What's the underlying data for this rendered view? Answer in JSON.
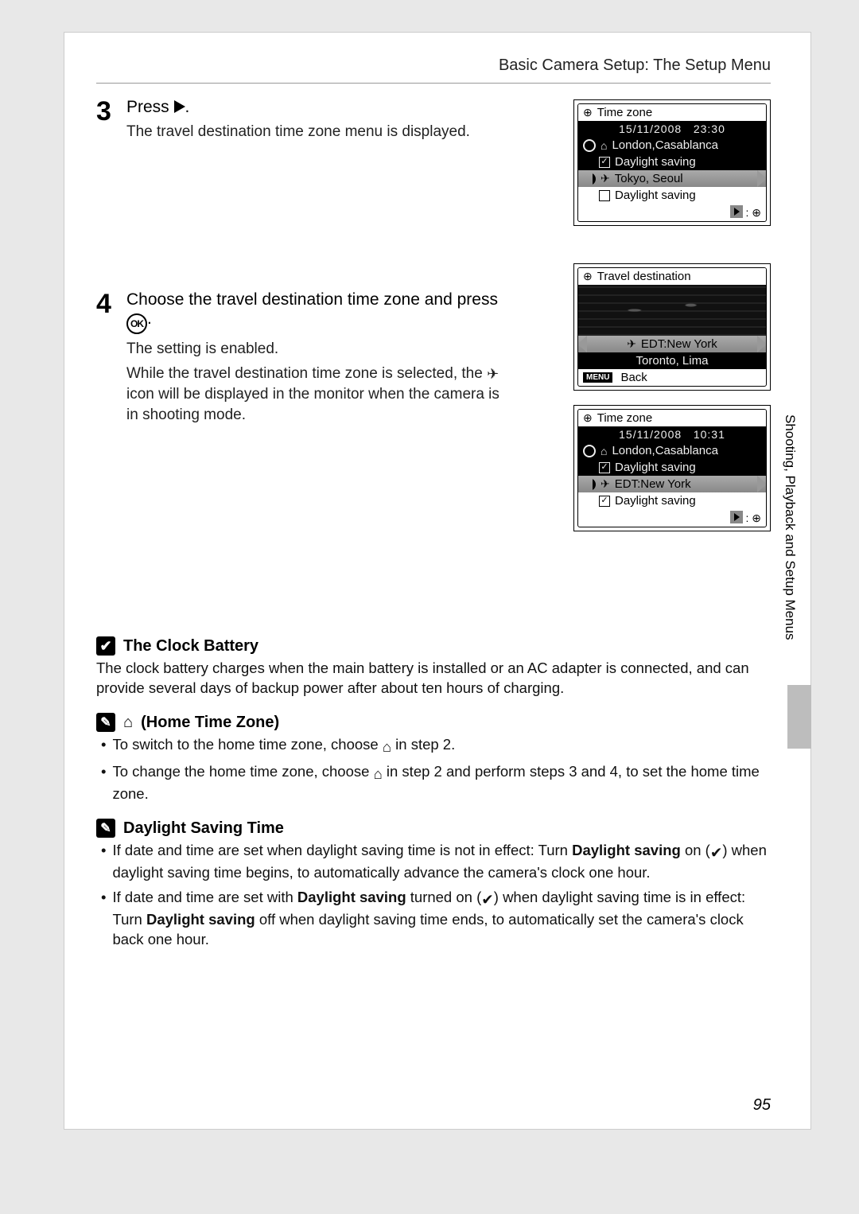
{
  "header": {
    "title": "Basic Camera Setup: The Setup Menu"
  },
  "step3": {
    "num": "3",
    "title_prefix": "Press ",
    "title_suffix": ".",
    "desc": "The travel destination time zone menu is displayed."
  },
  "step4": {
    "num": "4",
    "title_a": "Choose the travel destination time zone and press ",
    "title_b": ".",
    "desc1": "The setting is enabled.",
    "desc2a": "While the travel destination time zone is selected, the ",
    "desc2b": " icon will be displayed in the monitor when the camera is in shooting mode."
  },
  "lcd1": {
    "title": "Time zone",
    "date": "15/11/2008",
    "time": "23:30",
    "home": "London,Casablanca",
    "dst1": "Daylight saving",
    "dest": "Tokyo, Seoul",
    "dst2": "Daylight saving"
  },
  "lcd2": {
    "title": "Travel destination",
    "sel": "EDT:New York",
    "alt": "Toronto, Lima",
    "back": "Back"
  },
  "lcd3": {
    "title": "Time zone",
    "date": "15/11/2008",
    "time": "10:31",
    "home": "London,Casablanca",
    "dst1": "Daylight saving",
    "dest": "EDT:New York",
    "dst2": "Daylight saving"
  },
  "side_label": "Shooting, Playback and Setup Menus",
  "notes": {
    "clock": {
      "title": "The Clock Battery",
      "body": "The clock battery charges when the main battery is installed or an AC adapter is connected, and can provide several days of backup power after about ten hours of charging."
    },
    "home": {
      "title": "(Home Time Zone)",
      "b1a": "To switch to the home time zone, choose ",
      "b1b": " in step 2.",
      "b2a": "To change the home time zone, choose ",
      "b2b": " in step 2 and perform steps 3 and 4, to set the home time zone."
    },
    "dst_title": "Daylight Saving Time",
    "dst": {
      "b1a": "If date and time are set when daylight saving time is not in effect: Turn ",
      "b1bold": "Daylight saving",
      "b1b": " on (",
      "b1c": ") when daylight saving time begins, to automatically advance the camera's clock one hour.",
      "b2a": "If date and time are set with ",
      "b2bold1": "Daylight saving",
      "b2b": " turned on (",
      "b2c": ") when daylight saving time is in effect: Turn ",
      "b2bold2": "Daylight saving",
      "b2d": " off when daylight saving time ends, to automatically set the camera's clock back one hour."
    }
  },
  "page_number": "95"
}
